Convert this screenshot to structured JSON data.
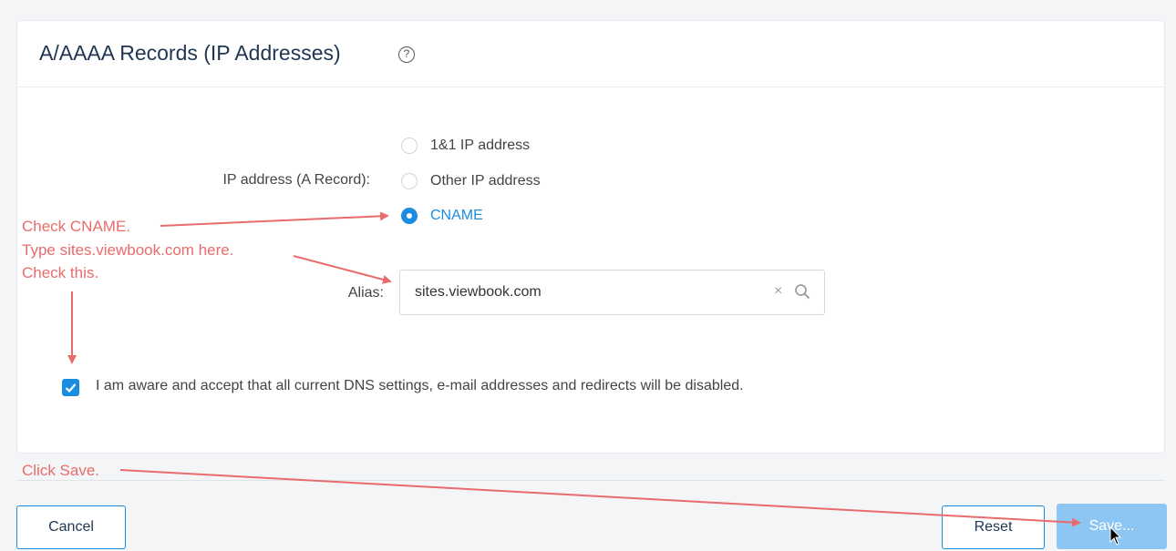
{
  "card": {
    "title": "A/AAAA Records (IP Addresses)",
    "help_icon": "?"
  },
  "form": {
    "ip_label": "IP address (A Record):",
    "radio_options": [
      {
        "label": "1&1 IP address",
        "checked": false
      },
      {
        "label": "Other IP address",
        "checked": false
      },
      {
        "label": "CNAME",
        "checked": true
      }
    ],
    "alias_label": "Alias:",
    "alias_value": "sites.viewbook.com",
    "clear_symbol": "×",
    "checkbox_label": "I am aware and accept that all current DNS settings, e-mail addresses and redirects will be disabled.",
    "checkbox_checked": true
  },
  "buttons": {
    "cancel": "Cancel",
    "reset": "Reset",
    "save": "Save..."
  },
  "annotations": {
    "check_cname": "Check CNAME.",
    "type_alias": "Type sites.viewbook.com here.",
    "check_this": "Check this.",
    "click_save": "Click Save."
  },
  "colors": {
    "accent": "#1b8de0",
    "annotation": "#ea6b6b",
    "save_button": "#8ec6f3"
  }
}
